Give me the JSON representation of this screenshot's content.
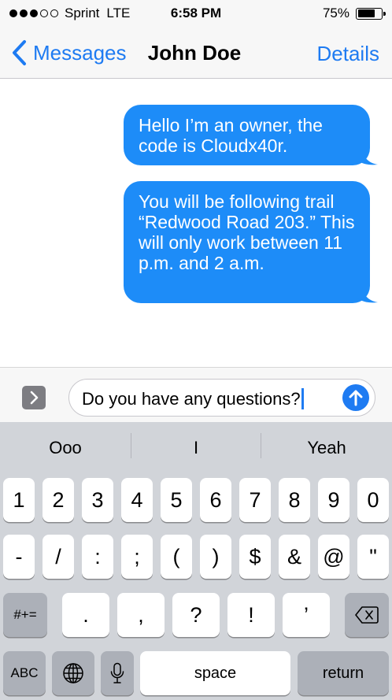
{
  "status_bar": {
    "carrier": "Sprint",
    "network": "LTE",
    "time": "6:58 PM",
    "battery": "75%",
    "battery_level": 0.75,
    "signal_bars_filled": 3,
    "signal_bars_total": 5
  },
  "nav": {
    "back_label": "Messages",
    "title": "John Doe",
    "details_label": "Details"
  },
  "messages": [
    {
      "direction": "outgoing",
      "text": "Hello I’m an owner, the code is Cloudx40r."
    },
    {
      "direction": "outgoing",
      "text": "You will be following trail “Redwood Road 203.” This will only work between 11 p.m. and 2 a.m."
    }
  ],
  "composer": {
    "text": "Do you have any questions?",
    "expand_icon": "chevron-right-icon",
    "send_icon": "arrow-up-icon"
  },
  "keyboard": {
    "suggestions": [
      "Ooo",
      "I",
      "Yeah"
    ],
    "row1": [
      "1",
      "2",
      "3",
      "4",
      "5",
      "6",
      "7",
      "8",
      "9",
      "0"
    ],
    "row2": [
      "-",
      "/",
      ":",
      ";",
      "(",
      ")",
      "$",
      "&",
      "@",
      "\""
    ],
    "row3": {
      "shift": "#+=",
      "keys": [
        ".",
        ",",
        "?",
        "!",
        "’"
      ],
      "delete_icon": "backspace-icon"
    },
    "row4": {
      "abc": "ABC",
      "globe_icon": "globe-icon",
      "mic_icon": "microphone-icon",
      "space": "space",
      "return": "return"
    }
  },
  "colors": {
    "accent": "#1e7bf2",
    "bubble": "#1d8cf8",
    "keyboard_bg": "#d1d4d9",
    "dark_key": "#acb0b8"
  }
}
